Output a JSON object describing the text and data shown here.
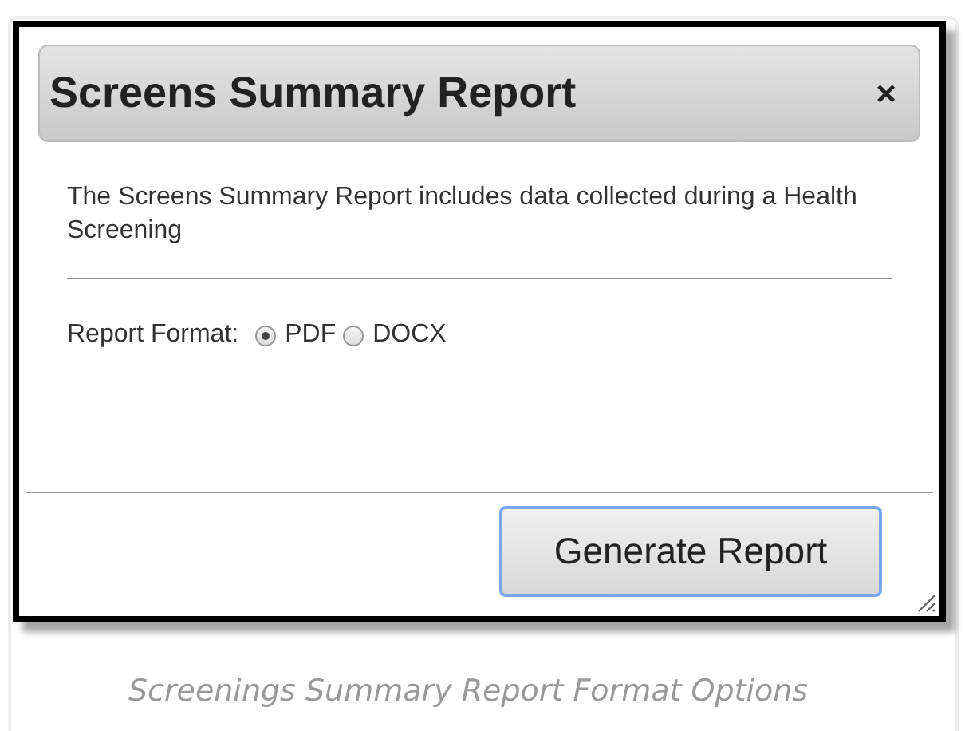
{
  "dialog": {
    "title": "Screens Summary Report",
    "close": "×",
    "description": "The Screens Summary Report includes data collected during a Health Screening",
    "format_label": "Report Format:",
    "formats": [
      {
        "label": "PDF",
        "selected": true
      },
      {
        "label": "DOCX",
        "selected": false
      }
    ],
    "button": "Generate Report"
  },
  "caption": "Screenings Summary Report Format Options"
}
